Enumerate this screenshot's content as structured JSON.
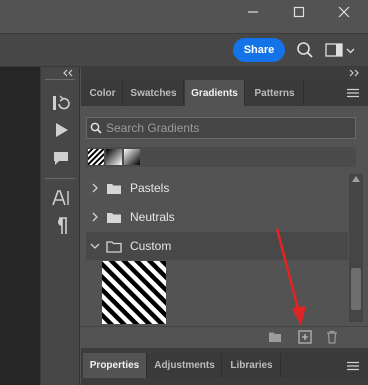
{
  "window": {
    "minimize_icon": "minimize-icon",
    "maximize_icon": "maximize-icon",
    "close_icon": "close-icon"
  },
  "optionsbar": {
    "share_label": "Share",
    "share_color": "#1473e6"
  },
  "panel": {
    "tabs": [
      {
        "label": "Color"
      },
      {
        "label": "Swatches"
      },
      {
        "label": "Gradients",
        "active": true
      },
      {
        "label": "Patterns"
      }
    ],
    "search_placeholder": "Search Gradients",
    "folders": [
      {
        "label": "Pastels",
        "expanded": false
      },
      {
        "label": "Neutrals",
        "expanded": false
      },
      {
        "label": "Custom",
        "expanded": true
      }
    ]
  },
  "bottom_panel": {
    "tabs": [
      {
        "label": "Properties",
        "active": true
      },
      {
        "label": "Adjustments"
      },
      {
        "label": "Libraries"
      }
    ]
  },
  "annotation": {
    "arrow_color": "#e02424"
  }
}
